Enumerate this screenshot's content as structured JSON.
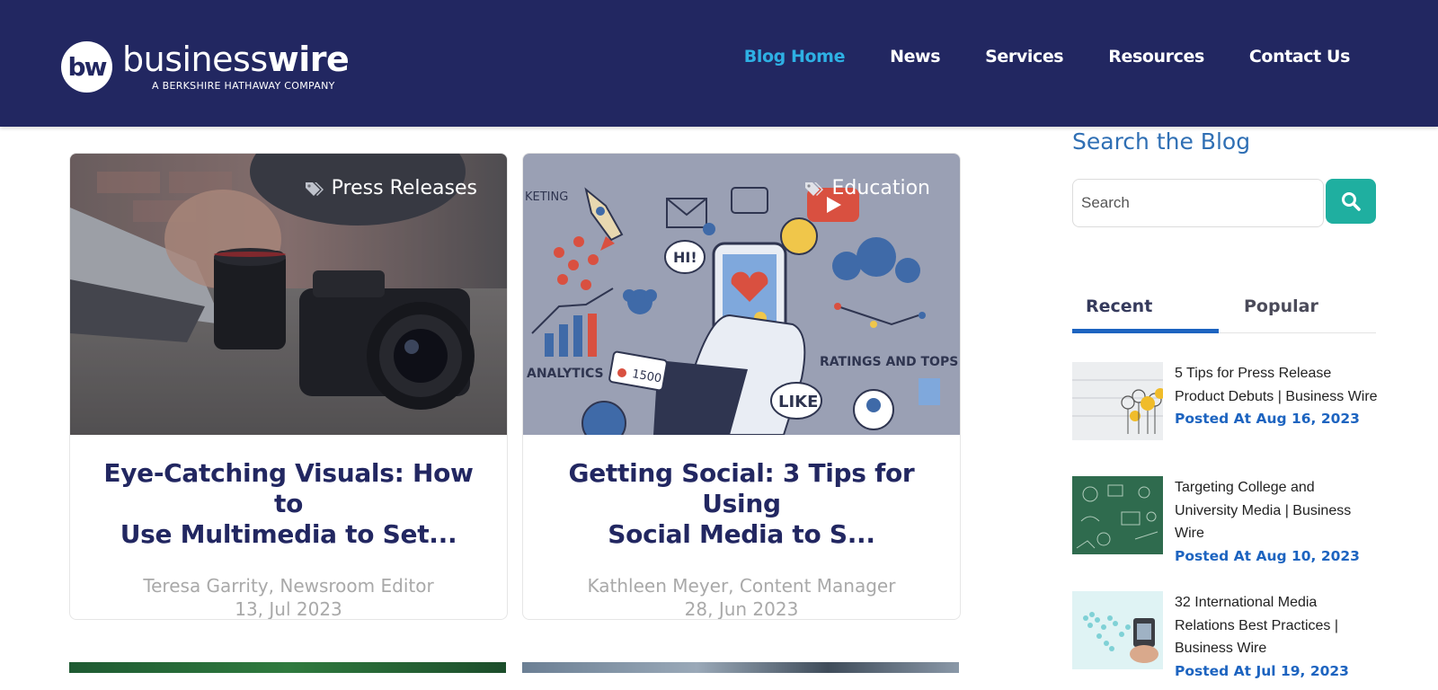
{
  "header": {
    "logo_mark": "bw",
    "logo_word_light": "business",
    "logo_word_bold": "wire",
    "logo_tagline": "A BERKSHIRE HATHAWAY COMPANY",
    "nav": [
      "Blog Home",
      "News",
      "Services",
      "Resources",
      "Contact Us"
    ],
    "active_nav": "Blog Home"
  },
  "cards": [
    {
      "tag": "Press Releases",
      "title_line1": "Eye-Catching Visuals: How to",
      "title_line2": "Use Multimedia to Set...",
      "author": "Teresa Garrity, Newsroom Editor",
      "date": "13, Jul 2023"
    },
    {
      "tag": "Education",
      "title_line1": "Getting Social: 3 Tips for Using",
      "title_line2": "Social Media to S...",
      "author": "Kathleen Meyer, Content Manager",
      "date": "28, Jun 2023",
      "image_text": {
        "marketing": "KETING",
        "hi": "HI!",
        "analytics": "ANALYTICS",
        "count": "1500",
        "ratings": "RATINGS AND TOPS",
        "like": "LIKE"
      }
    }
  ],
  "sidebar": {
    "search_title": "Search the Blog",
    "search_placeholder": "Search",
    "tabs": [
      "Recent",
      "Popular"
    ],
    "active_tab": "Recent",
    "posts": [
      {
        "title": "5 Tips for Press Release Product Debuts | Business Wire",
        "date": "Posted At Aug 16, 2023"
      },
      {
        "title": "Targeting College and University Media | Business Wire",
        "date": "Posted At Aug 10, 2023"
      },
      {
        "title": "32 International Media Relations Best Practices | Business Wire",
        "date": "Posted At Jul 19, 2023"
      }
    ]
  },
  "colors": {
    "header_bg": "#222761",
    "nav_active": "#2eb0e4",
    "title_navy": "#222761",
    "accent_blue": "#1d64c0",
    "search_button": "#1fafa0"
  },
  "icons": [
    "tag-icon",
    "search-icon"
  ]
}
